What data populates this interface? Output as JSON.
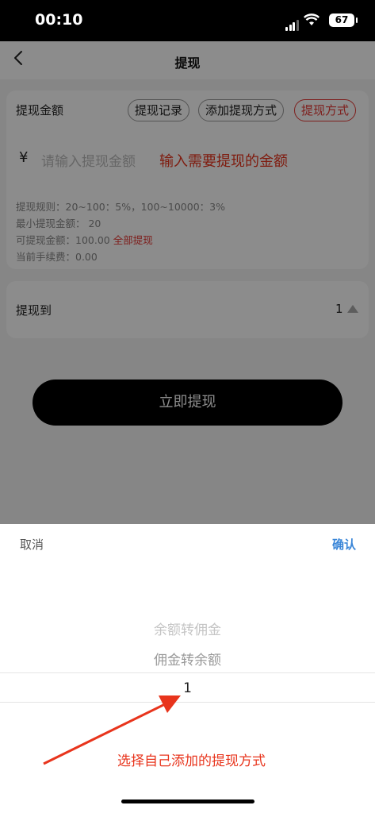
{
  "status_bar": {
    "time": "00:10",
    "battery": "67"
  },
  "nav": {
    "title": "提现"
  },
  "amount_card": {
    "label": "提现金额",
    "buttons": [
      "提现记录",
      "添加提现方式",
      "提现方式"
    ],
    "currency": "¥",
    "input_placeholder": "请输入提现金额",
    "annotation": "输入需要提现的金额"
  },
  "rules": {
    "rule": "提现规则：20~100：5%，100~10000：3%",
    "min": "最小提现金额：  20",
    "available": "可提现金额：100.00",
    "withdraw_all": "全部提现",
    "fee": "当前手续费：0.00"
  },
  "destination": {
    "label": "提现到",
    "value": "1"
  },
  "submit_button": "立即提现",
  "picker": {
    "cancel": "取消",
    "confirm": "确认",
    "options": [
      "余额转佣金",
      "佣金转余额",
      "1"
    ],
    "annotation": "选择自己添加的提现方式"
  },
  "colors": {
    "accent_red": "#e53935",
    "confirm_blue": "#3a86d8",
    "annotation_red": "#e8341c"
  }
}
